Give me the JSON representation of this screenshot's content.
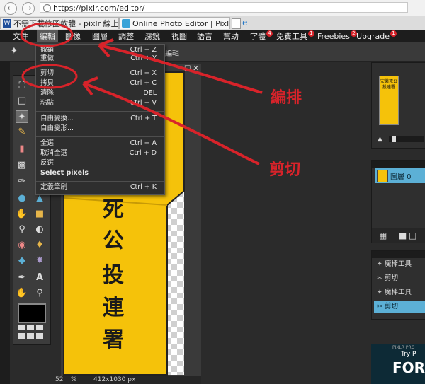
{
  "browser": {
    "url": "https://pixlr.com/editor/",
    "tabs": [
      {
        "label": "不需下載修圖軟體 - pixlr 線上...",
        "icon": "W"
      },
      {
        "label": "Online Photo Editor | Pixlr..."
      }
    ]
  },
  "menubar": {
    "items": [
      "文件",
      "編輯",
      "圖像",
      "圖層",
      "調整",
      "濾鏡",
      "視圖",
      "語言",
      "幫助",
      "字體",
      "免費工具",
      "Freebies",
      "Upgrade"
    ],
    "badges": {
      "字體": "4",
      "免費工具": "1",
      "Freebies": "2",
      "Upgrade": "1"
    }
  },
  "options_bar": {
    "label": "編輯"
  },
  "edit_menu": {
    "items": [
      {
        "label": "撤銷",
        "shortcut": "Ctrl + Z"
      },
      {
        "label": "重做",
        "shortcut": "Ctrl + Y"
      },
      {
        "label": "剪切",
        "shortcut": "Ctrl + X"
      },
      {
        "label": "拷貝",
        "shortcut": "Ctrl + C"
      },
      {
        "label": "清除",
        "shortcut": "DEL"
      },
      {
        "label": "粘貼",
        "shortcut": "Ctrl + V"
      },
      {
        "label": "自由變換...",
        "shortcut": "Ctrl + T"
      },
      {
        "label": "自由變形...",
        "shortcut": ""
      },
      {
        "label": "全選",
        "shortcut": "Ctrl + A"
      },
      {
        "label": "取消全選",
        "shortcut": "Ctrl + D"
      },
      {
        "label": "反選",
        "shortcut": ""
      },
      {
        "label": "Select pixels",
        "shortcut": ""
      },
      {
        "label": "定義筆刷",
        "shortcut": "Ctrl + K"
      }
    ]
  },
  "canvas": {
    "image_text": [
      "安",
      "樂",
      "死",
      "公",
      "投",
      "連",
      "署"
    ],
    "thumb_text": "安樂死公投連署",
    "zoom": "52",
    "zoom_unit": "%",
    "dimensions": "412x1030 px"
  },
  "layers": {
    "layer_name": "圖層 0"
  },
  "history": {
    "items": [
      "魔棒工具",
      "剪切",
      "魔棒工具",
      "剪切"
    ],
    "selected_index": 3
  },
  "ad": {
    "line1": "PIXLR PRO",
    "line2": "Try P",
    "line3": "FOR"
  },
  "annotations": {
    "edit_label": "編排",
    "cut_label": "剪切"
  },
  "colors": {
    "accent": "#5cb0d6",
    "annotation_red": "#d8232a",
    "vest_yellow": "#f5c20a"
  }
}
